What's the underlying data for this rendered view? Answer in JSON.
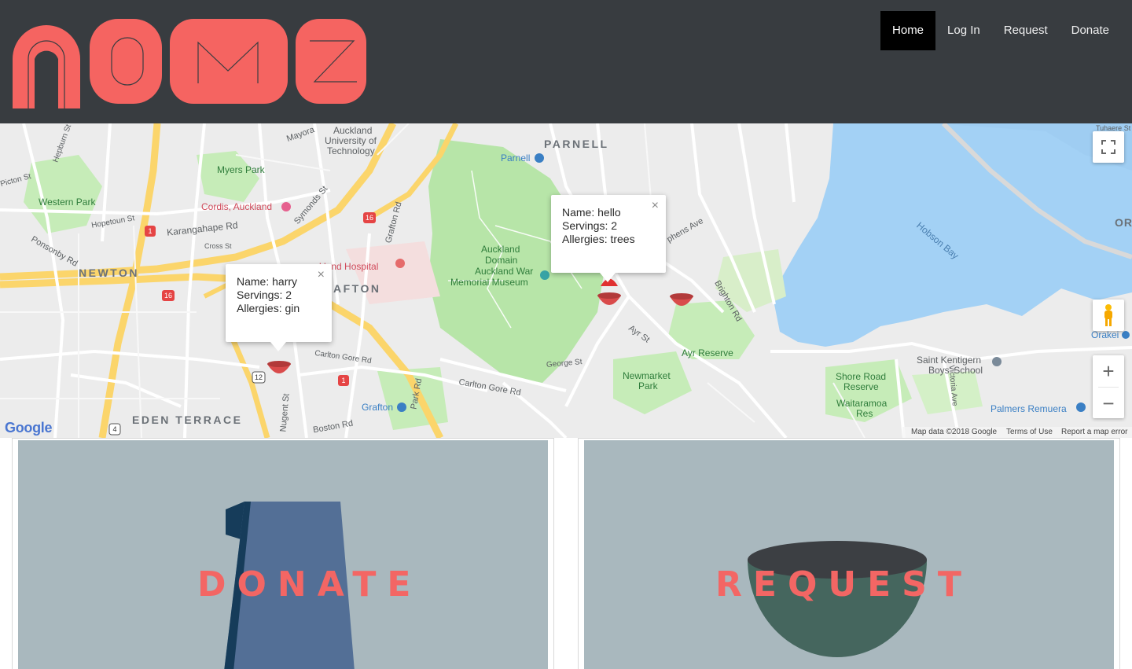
{
  "header": {
    "logo_text": "NOMZ",
    "nav": [
      {
        "label": "Home",
        "active": true
      },
      {
        "label": "Log In",
        "active": false
      },
      {
        "label": "Request",
        "active": false
      },
      {
        "label": "Donate",
        "active": false
      }
    ]
  },
  "map": {
    "labels": {
      "parnell": "PARNELL",
      "newton": "NEWTON",
      "grafton": "AFTON",
      "eden_terrace": "EDEN TERRACE",
      "auckland_uni": "Auckland",
      "auckland_uni2": "University of",
      "auckland_uni3": "Technology",
      "myers_park": "Myers Park",
      "western_park": "Western Park",
      "cordis": "Cordis, Auckland",
      "auckland_hospital": "kland Hospital",
      "auckland_domain": "Auckland",
      "auckland_domain2": "Domain",
      "war_memorial": "Auckland War",
      "war_memorial2": "Memorial Museum",
      "parnell_station": "Parnell",
      "grafton_station": "Grafton",
      "ayr_reserve": "Ayr Reserve",
      "newmarket_park": "Newmarket",
      "newmarket_park2": "Park",
      "shore_road": "Shore Road",
      "shore_road2": "Reserve",
      "waitaramoa": "Waitaramoa",
      "waitaramoa2": "Res",
      "saint_kentigern": "Saint Kentigern",
      "saint_kentigern2": "Boys' School",
      "palmers": "Palmers Remuera",
      "hobson_bay": "Hobson Bay",
      "orakei": "Orakei",
      "or_edge": "OR",
      "karangahape": "Karangahape Rd",
      "symonds": "Symonds St",
      "mayoral": "Mayora",
      "ponsonby": "Ponsonby Rd",
      "hopetoun": "Hopetoun St",
      "picton": "Picton St",
      "hepburn": "Hepburn St",
      "carlton_gore": "Carlton Gore Rd",
      "carlton_gore2": "Carlton Gore Rd",
      "ayr_st": "Ayr St",
      "brighton": "Brighton Rd",
      "stephens": "phens Ave",
      "nugent": "Nugent St",
      "boston": "Boston Rd",
      "grafton_rd": "Grafton Rd",
      "park_rd": "Park Rd",
      "george_st": "George St",
      "tuhaere": "Tuhaere St",
      "cross_st": "Cross St",
      "victoria_ave": "Victoria Ave"
    },
    "info_windows": [
      {
        "name": "Name: harry",
        "servings": "Servings: 2",
        "allergies": "Allergies: gin"
      },
      {
        "name": "Name: hello",
        "servings": "Servings: 2",
        "allergies": "Allergies: trees"
      }
    ],
    "close_glyph": "×",
    "zoom_in": "+",
    "zoom_out": "−",
    "google": "Google",
    "attribution": {
      "map_data": "Map data ©2018 Google",
      "terms": "Terms of Use",
      "report": "Report a map error"
    },
    "route_badges": [
      "1",
      "16",
      "16",
      "12",
      "1",
      "4",
      "1"
    ]
  },
  "cards": [
    {
      "title": "DONATE"
    },
    {
      "title": "REQUEST"
    }
  ],
  "colors": {
    "header_bg": "#383c40",
    "brand_coral": "#f36664",
    "card_bg": "#a9b8be",
    "water": "#a3d1f5",
    "park": "#b7e5a8",
    "highway": "#fbd56b"
  },
  "icons": {
    "fullscreen": "fullscreen-icon",
    "pegman": "pegman-icon",
    "marker": "bowl-marker-icon"
  }
}
